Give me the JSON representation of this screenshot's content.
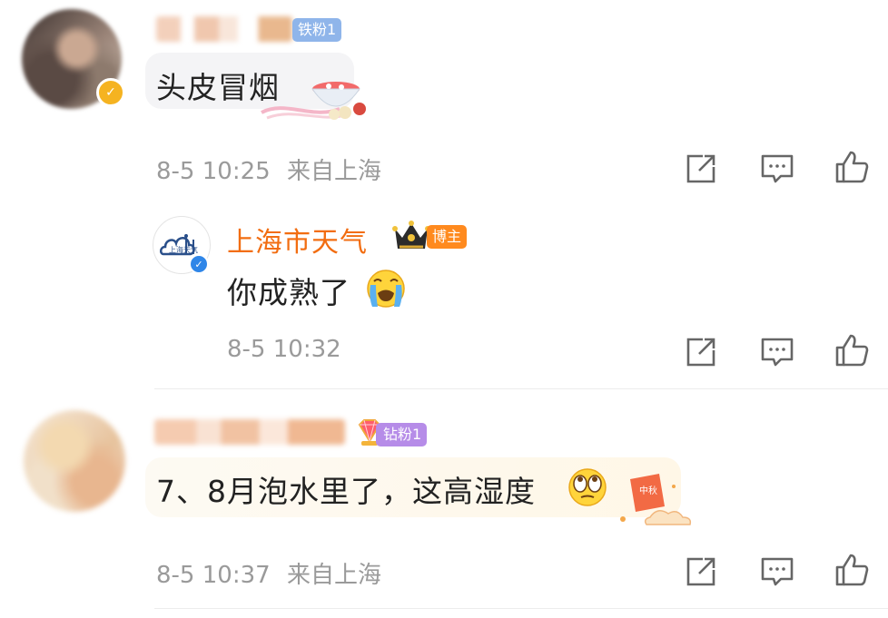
{
  "comments": [
    {
      "badge": "铁粉1",
      "text": "头皮冒烟",
      "time": "8-5 10:25",
      "location": "来自上海"
    },
    {
      "username": "上海市天气",
      "avatar_text": "上海天气",
      "role_badge": "博主",
      "text": "你成熟了",
      "time": "8-5 10:32"
    },
    {
      "badge": "钻粉1",
      "text": "7、8月泡水里了，这高湿度",
      "time": "8-5 10:37",
      "location": "来自上海",
      "decoration_text": "中秋"
    }
  ],
  "icons": {
    "share": "share-icon",
    "comment": "comment-icon",
    "like": "thumbs-up-icon"
  },
  "colors": {
    "orange": "#f26d11",
    "meta_gray": "#9a9a9a",
    "icon_gray": "#666666"
  }
}
